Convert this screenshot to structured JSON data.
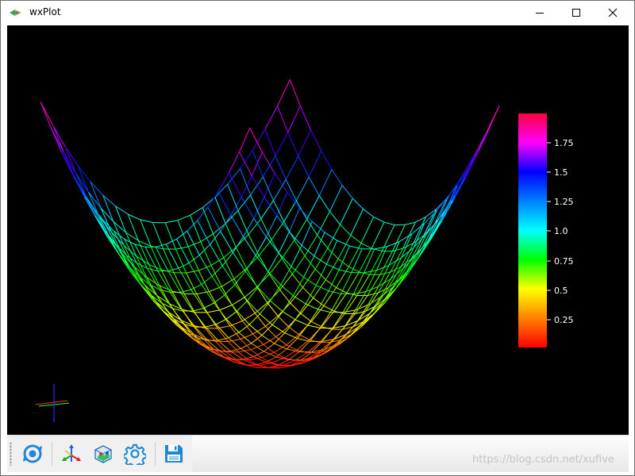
{
  "window": {
    "title": "wxPlot"
  },
  "toolbar": {
    "buttons": [
      {
        "name": "reset-view",
        "icon": "reset-view-icon"
      },
      {
        "name": "axes",
        "icon": "axes-icon"
      },
      {
        "name": "bounding-box",
        "icon": "box-cube-icon"
      },
      {
        "name": "settings",
        "icon": "gear-icon"
      },
      {
        "name": "save",
        "icon": "save-icon"
      }
    ]
  },
  "colorbar": {
    "ticks": [
      "0.25",
      "0.5",
      "0.75",
      "1.0",
      "1.25",
      "1.5",
      "1.75"
    ]
  },
  "colors": {
    "canvas_bg": "#000000",
    "accent_blue": "#1e88d6"
  },
  "watermark": "https://blog.csdn.net/xufive"
}
